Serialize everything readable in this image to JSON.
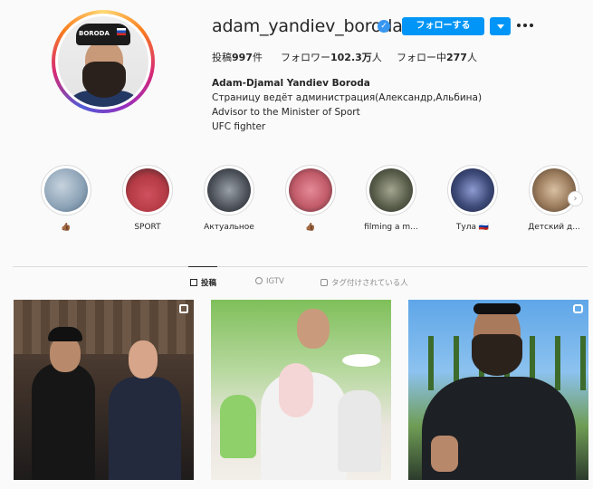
{
  "profile": {
    "username": "adam_yandiev_boroda",
    "verified_icon": "verified-badge-icon",
    "follow_label": "フォローする",
    "cap_text": "BORODA",
    "stats": {
      "posts_label": "投稿",
      "posts_value": "997",
      "posts_unit": "件",
      "followers_label": "フォロワー",
      "followers_value": "102.3万",
      "followers_unit": "人",
      "following_label": "フォロー中",
      "following_value": "277",
      "following_unit": "人"
    },
    "bio": {
      "name": "Adam-Djamal Yandiev Boroda",
      "line1": "Страницу ведёт администрация(Александр,Альбина)",
      "line2": "Advisor to the Minister of Sport",
      "line3": "UFC fighter"
    }
  },
  "highlights": [
    {
      "label": "👍🏾",
      "color": "#8aa1b5"
    },
    {
      "label": "SPORT",
      "color": "#b33a45"
    },
    {
      "label": "Актуальное",
      "color": "#4a4f57"
    },
    {
      "label": "👍🏾",
      "color": "#c25b6a"
    },
    {
      "label": "filming a m...",
      "color": "#5a5f4c"
    },
    {
      "label": "Тула 🇷🇺",
      "color": "#3d4a78"
    },
    {
      "label": "Детский д...",
      "color": "#9a7b5c"
    }
  ],
  "tabs": [
    {
      "label": "投稿",
      "icon": "grid-icon",
      "active": true
    },
    {
      "label": "IGTV",
      "icon": "igtv-icon",
      "active": false
    },
    {
      "label": "タグ付けされている人",
      "icon": "tagged-icon",
      "active": false
    }
  ],
  "colors": {
    "accent": "#0095f6",
    "text": "#262626",
    "muted": "#8e8e8e"
  }
}
